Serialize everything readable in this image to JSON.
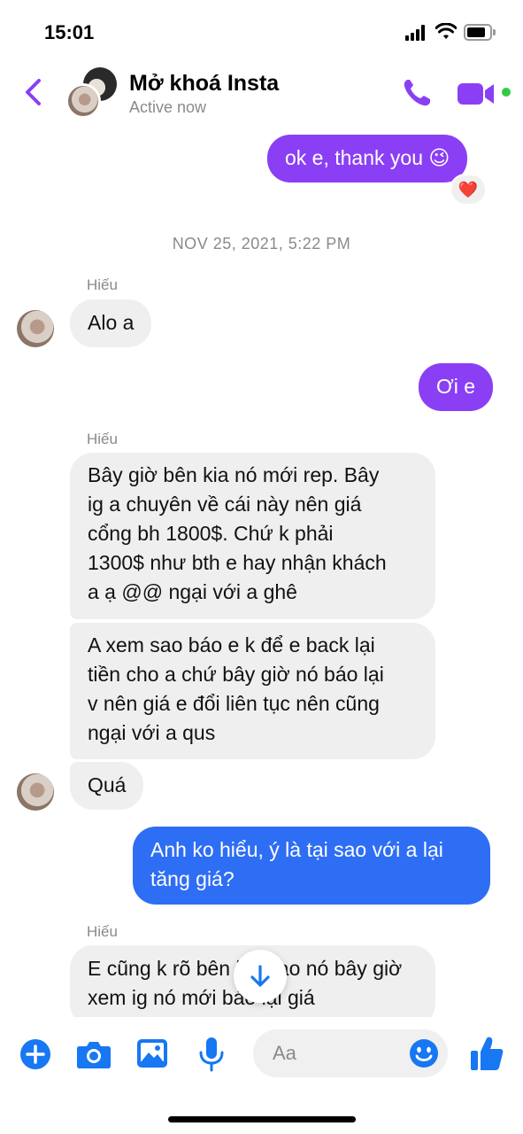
{
  "status_bar": {
    "time": "15:01"
  },
  "header": {
    "contact_name": "Mở khoá Insta",
    "status": "Active now"
  },
  "messages": {
    "m1": {
      "text": "ok e, thank you 😉",
      "reaction": "❤️"
    },
    "timestamp": "NOV 25, 2021, 5:22 PM",
    "sender1": "Hiếu",
    "m2": "Alo a",
    "m3": "Ơi e",
    "sender2": "Hiếu",
    "m4": [
      "Bây giờ bên kia nó mới rep. Bây",
      "ig a chuyên về cái này nên giá",
      "cổng bh 1800$. Chứ k phải",
      "1300$ như bth e hay nhận khách",
      "a ạ @@ ngại với a ghê"
    ],
    "m5": [
      "A xem sao báo e k để e back lại",
      "tiền cho a chứ bây giờ nó báo lại",
      "v nên giá e đổi liên tục nên cũng",
      "ngại với a qus"
    ],
    "m6": "Quá",
    "m7": [
      "Anh ko hiểu, ý là tại sao với a lại",
      "tăng giá?"
    ],
    "sender3": "Hiếu",
    "m8": [
      "E cũng k rõ bên kia sao nó bây giờ",
      "xem ig nó mới báo lại giá"
    ]
  },
  "composer": {
    "placeholder": "Aa"
  },
  "colors": {
    "accent": "#8b3ff4",
    "outgoing_blue": "#2e6ef5",
    "icon_blue": "#1877f2",
    "online": "#31cc46"
  },
  "icons": [
    "back-icon",
    "phone-icon",
    "video-icon",
    "plus-icon",
    "camera-icon",
    "gallery-icon",
    "mic-icon",
    "emoji-icon",
    "thumbs-up-icon",
    "arrow-down-icon"
  ]
}
